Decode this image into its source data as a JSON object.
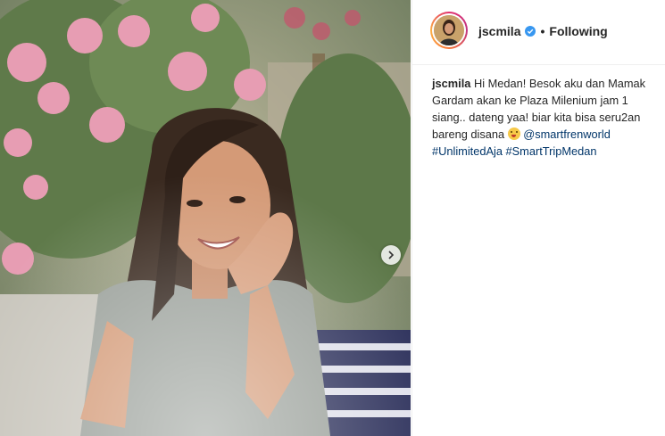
{
  "post": {
    "username": "jscmila",
    "follow_status": "Following",
    "separator": "•",
    "caption": {
      "username": "jscmila",
      "text": "Hi Medan! Besok aku dan Mamak Gardam akan ke Plaza Milenium jam 1 siang.. dateng yaa! biar kita bisa seru2an bareng disana",
      "mention": "@smartfrenworld",
      "hashtags": [
        "#UnlimitedAja",
        "#SmartTripMedan"
      ]
    }
  },
  "icons": {
    "verified": "verified-badge-icon",
    "next": "chevron-right-icon",
    "emoji": "smiling-emoji-icon"
  },
  "colors": {
    "verified": "#3897f0",
    "link": "#003569",
    "text": "#262626"
  }
}
